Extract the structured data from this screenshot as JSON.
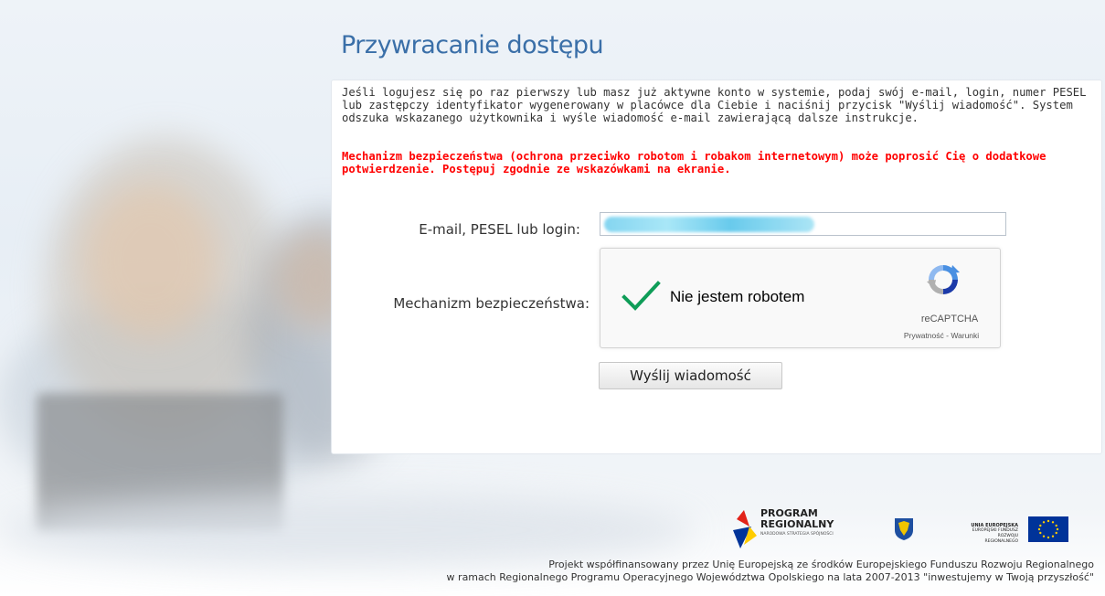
{
  "page": {
    "title": "Przywracanie dostępu"
  },
  "intro_text": "Jeśli logujesz się po raz pierwszy lub masz już aktywne konto w systemie, podaj swój e-mail, login, numer PESEL lub zastępczy identyfikator wygenerowany w placówce dla Ciebie i naciśnij przycisk \"Wyślij wiadomość\". System odszuka wskazanego użytkownika i wyśle wiadomość e-mail zawierającą dalsze instrukcje.",
  "warning_text": "Mechanizm bezpieczeństwa (ochrona przeciwko robotom i robakom internetowym) może poprosić Cię o dodatkowe potwierdzenie. Postępuj zgodnie ze wskazówkami na ekranie.",
  "form": {
    "email_label": "E-mail, PESEL lub login:",
    "email_value": "",
    "security_label": "Mechanizm bezpieczeństwa:",
    "submit_label": "Wyślij wiadomość"
  },
  "recaptcha": {
    "checkbox_label": "Nie jestem robotem",
    "checked": true,
    "brand": "reCAPTCHA",
    "links": "Prywatność - Warunki",
    "check_color": "#0f9d58",
    "logo_icon": "recaptcha-logo-icon"
  },
  "logos": {
    "program_line1": "PROGRAM",
    "program_line2": "REGIONALNY",
    "program_sub": "NARODOWA STRATEGIA SPÓJNOŚCI",
    "eu_title": "UNIA EUROPEJSKA",
    "eu_line1": "EUROPEJSKI FUNDUSZ",
    "eu_line2": "ROZWOJU REGIONALNEGO"
  },
  "footer": {
    "line1": "Projekt współfinansowany przez Unię Europejską ze środków Europejskiego Funduszu Rozwoju Regionalnego",
    "line2": "w ramach Regionalnego Programu Operacyjnego Województwa Opolskiego na lata 2007-2013 \"inwestujemy w Twoją przyszłość\""
  },
  "colors": {
    "title": "#3a6fa8",
    "warning": "#ff0000",
    "eu_blue": "#003399",
    "eu_yellow": "#ffcc00"
  }
}
